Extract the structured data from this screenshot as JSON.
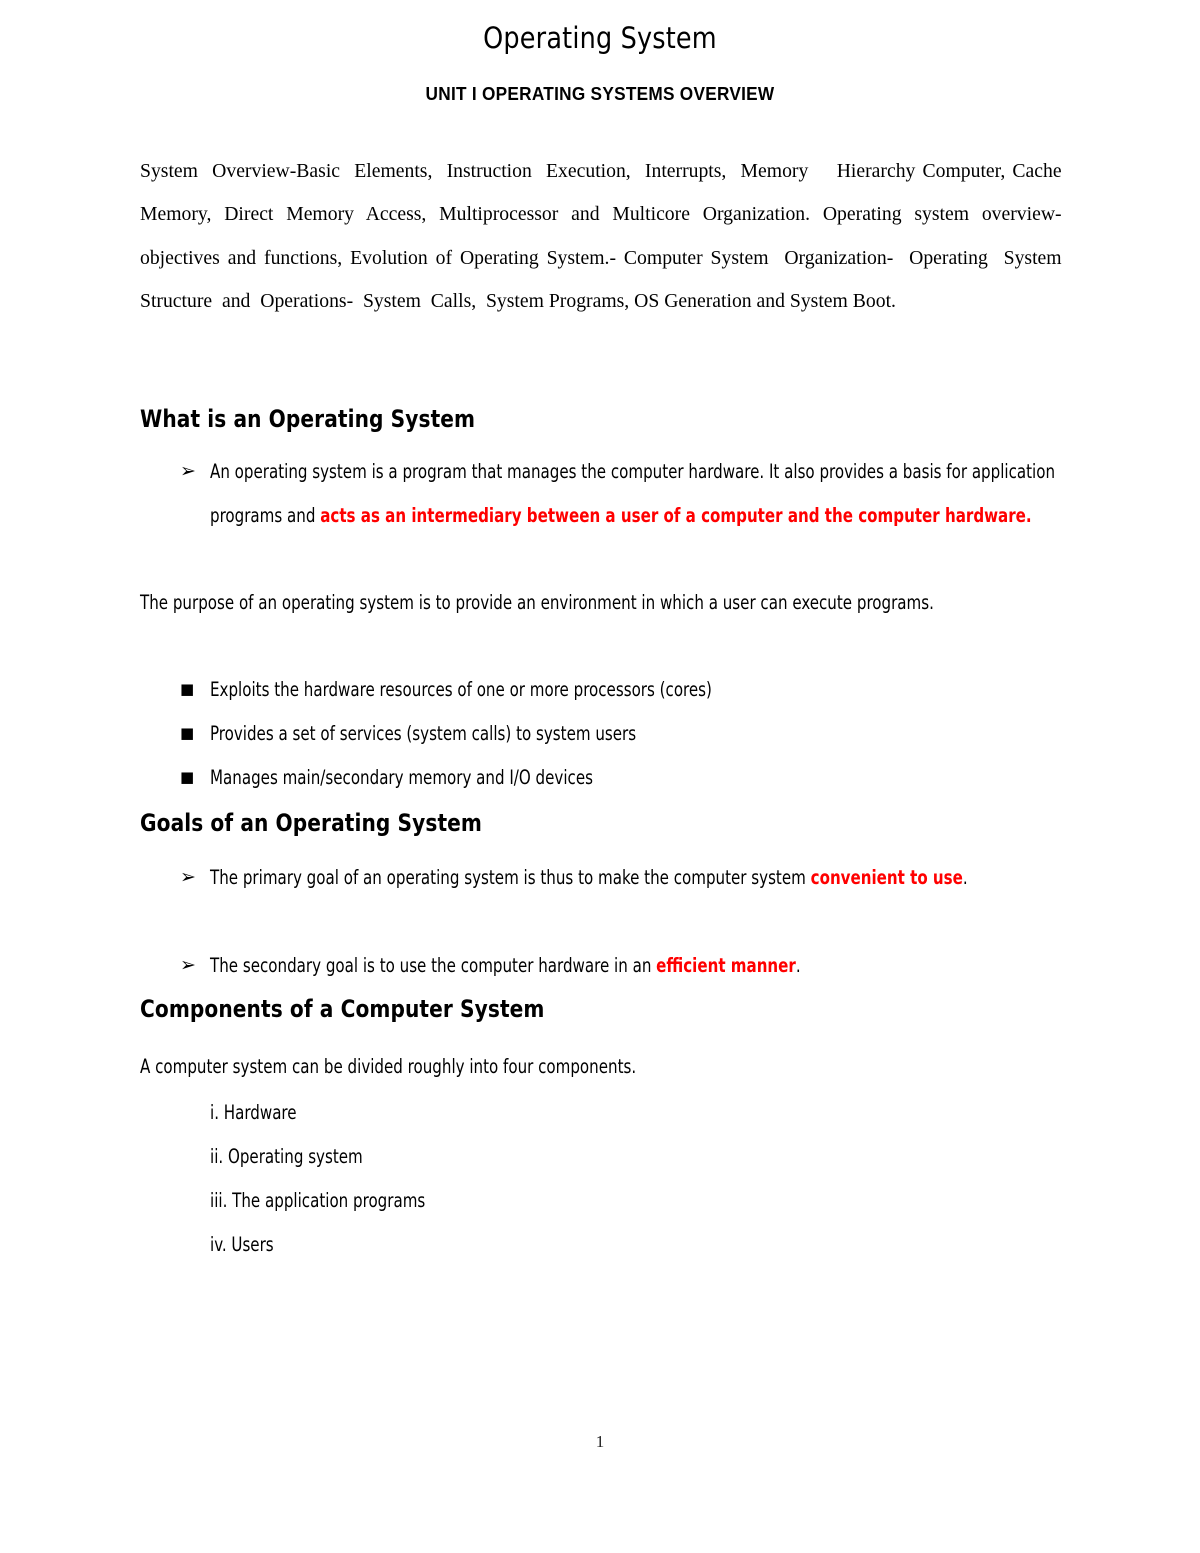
{
  "document": {
    "title": "Operating System",
    "subtitle": "UNIT I OPERATING SYSTEMS OVERVIEW",
    "page_number": "1",
    "accent_color": "#FF0000",
    "text_color": "#000000",
    "background_color": "#FFFFFF"
  },
  "intro": {
    "paragraph": "System  Overview-Basic  Elements,  Instruction  Execution,  Interrupts,  Memory    Hierarchy Computer, Cache Memory, Direct Memory Access, Multiprocessor and Multicore Organization. Operating system overview-objectives and functions, Evolution of Operating System.- Computer System  Organization-  Operating  System  Structure  and  Operations-  System  Calls,  System Programs, OS Generation and System Boot."
  },
  "sections": [
    {
      "heading": "What is an Operating System",
      "arrow_bullets": [
        {
          "glyph": "➢",
          "text_before": "An operating system is a program that manages the computer hardware. It also provides a basis for application programs and ",
          "text_highlight": "acts as an intermediary between a user of a computer and the computer hardware.",
          "text_after": ""
        }
      ],
      "paragraph": "The purpose of an operating system is to provide an environment in which a user can execute programs.",
      "square_bullets": [
        {
          "glyph": "■",
          "text": "Exploits the hardware resources of one or more processors (cores)"
        },
        {
          "glyph": "■",
          "text": "Provides a set of services (system calls) to system users"
        },
        {
          "glyph": "■",
          "text": "Manages main/secondary memory and I/O devices"
        }
      ]
    },
    {
      "heading": "Goals of an Operating System",
      "arrow_bullets": [
        {
          "glyph": "➢",
          "text_before": "The primary goal of an operating system is thus to make the computer system ",
          "text_highlight": "convenient to use",
          "text_after": "."
        },
        {
          "glyph": "➢",
          "text_before": "The secondary goal is to use the computer hardware in an ",
          "text_highlight": "efficient manner",
          "text_after": "."
        }
      ]
    },
    {
      "heading": "Components of a Computer System",
      "paragraph": "A computer system can be divided roughly into four components.",
      "numbered_items": [
        "i. Hardware",
        "ii. Operating system",
        "iii. The application programs",
        "iv. Users"
      ]
    }
  ]
}
